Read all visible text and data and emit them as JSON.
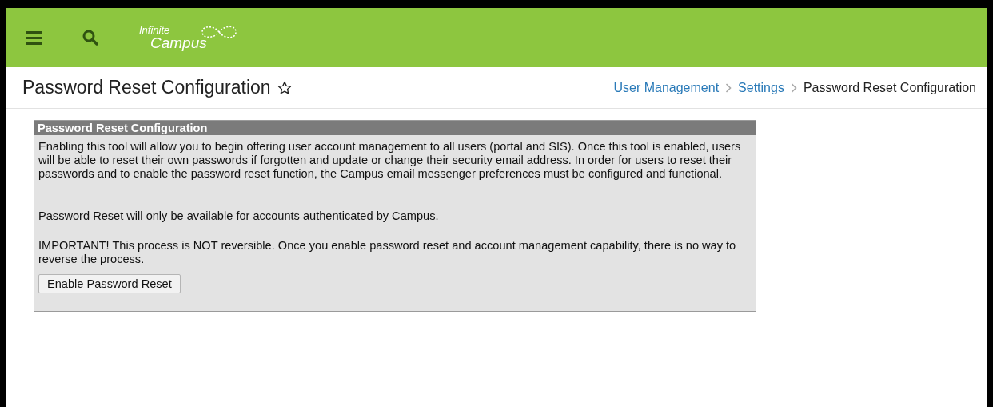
{
  "header": {
    "logo": {
      "line_1": "Infinite",
      "line_2": "Campus"
    }
  },
  "page": {
    "title": "Password Reset Configuration",
    "favorite": false,
    "breadcrumb": [
      {
        "label": "User Management",
        "kind": "link"
      },
      {
        "label": "Settings",
        "kind": "link"
      },
      {
        "label": "Password Reset Configuration",
        "kind": "current"
      }
    ]
  },
  "panel": {
    "title": "Password Reset Configuration",
    "paragraphs": [
      "Enabling this tool will allow you to begin offering user account management to all users (portal and SIS). Once this tool is enabled, users will be able to reset their own passwords if forgotten and update or change their security email address. In order for users to reset their passwords and to enable the password reset function, the Campus email messenger preferences must be configured and functional.",
      "Password Reset will only be available for accounts authenticated by Campus.",
      "IMPORTANT! This process is NOT reversible. Once you enable password reset and account management capability, there is no way to reverse the process."
    ],
    "button": "Enable Password Reset"
  }
}
